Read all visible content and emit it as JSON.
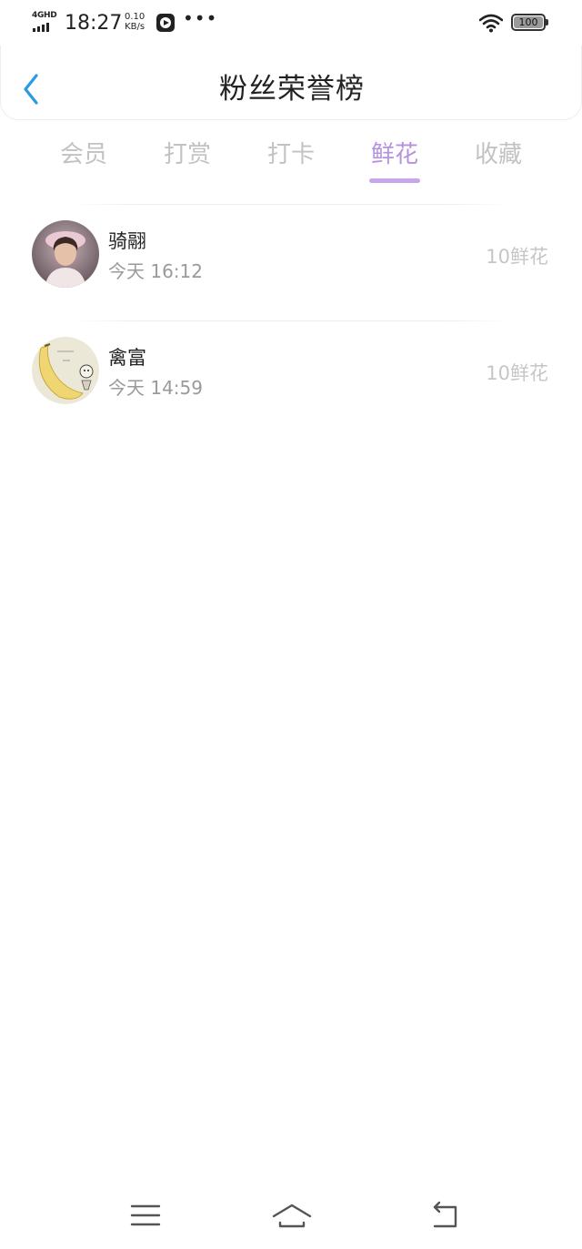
{
  "status_bar": {
    "network": "4GHD",
    "time": "18:27",
    "speed_value": "0.10",
    "speed_unit": "KB/s",
    "dots": "•••",
    "battery": "100"
  },
  "header": {
    "title": "粉丝荣誉榜"
  },
  "tabs": [
    {
      "label": "会员",
      "active": false
    },
    {
      "label": "打赏",
      "active": false
    },
    {
      "label": "打卡",
      "active": false
    },
    {
      "label": "鲜花",
      "active": true
    },
    {
      "label": "收藏",
      "active": false
    }
  ],
  "fans": [
    {
      "name": "骑翮",
      "time": "今天 16:12",
      "amount": "10鲜花"
    },
    {
      "name": "禽富",
      "time": "今天 14:59",
      "amount": "10鲜花"
    }
  ],
  "colors": {
    "accent": "#b492dd",
    "back_icon": "#2a9be0"
  }
}
